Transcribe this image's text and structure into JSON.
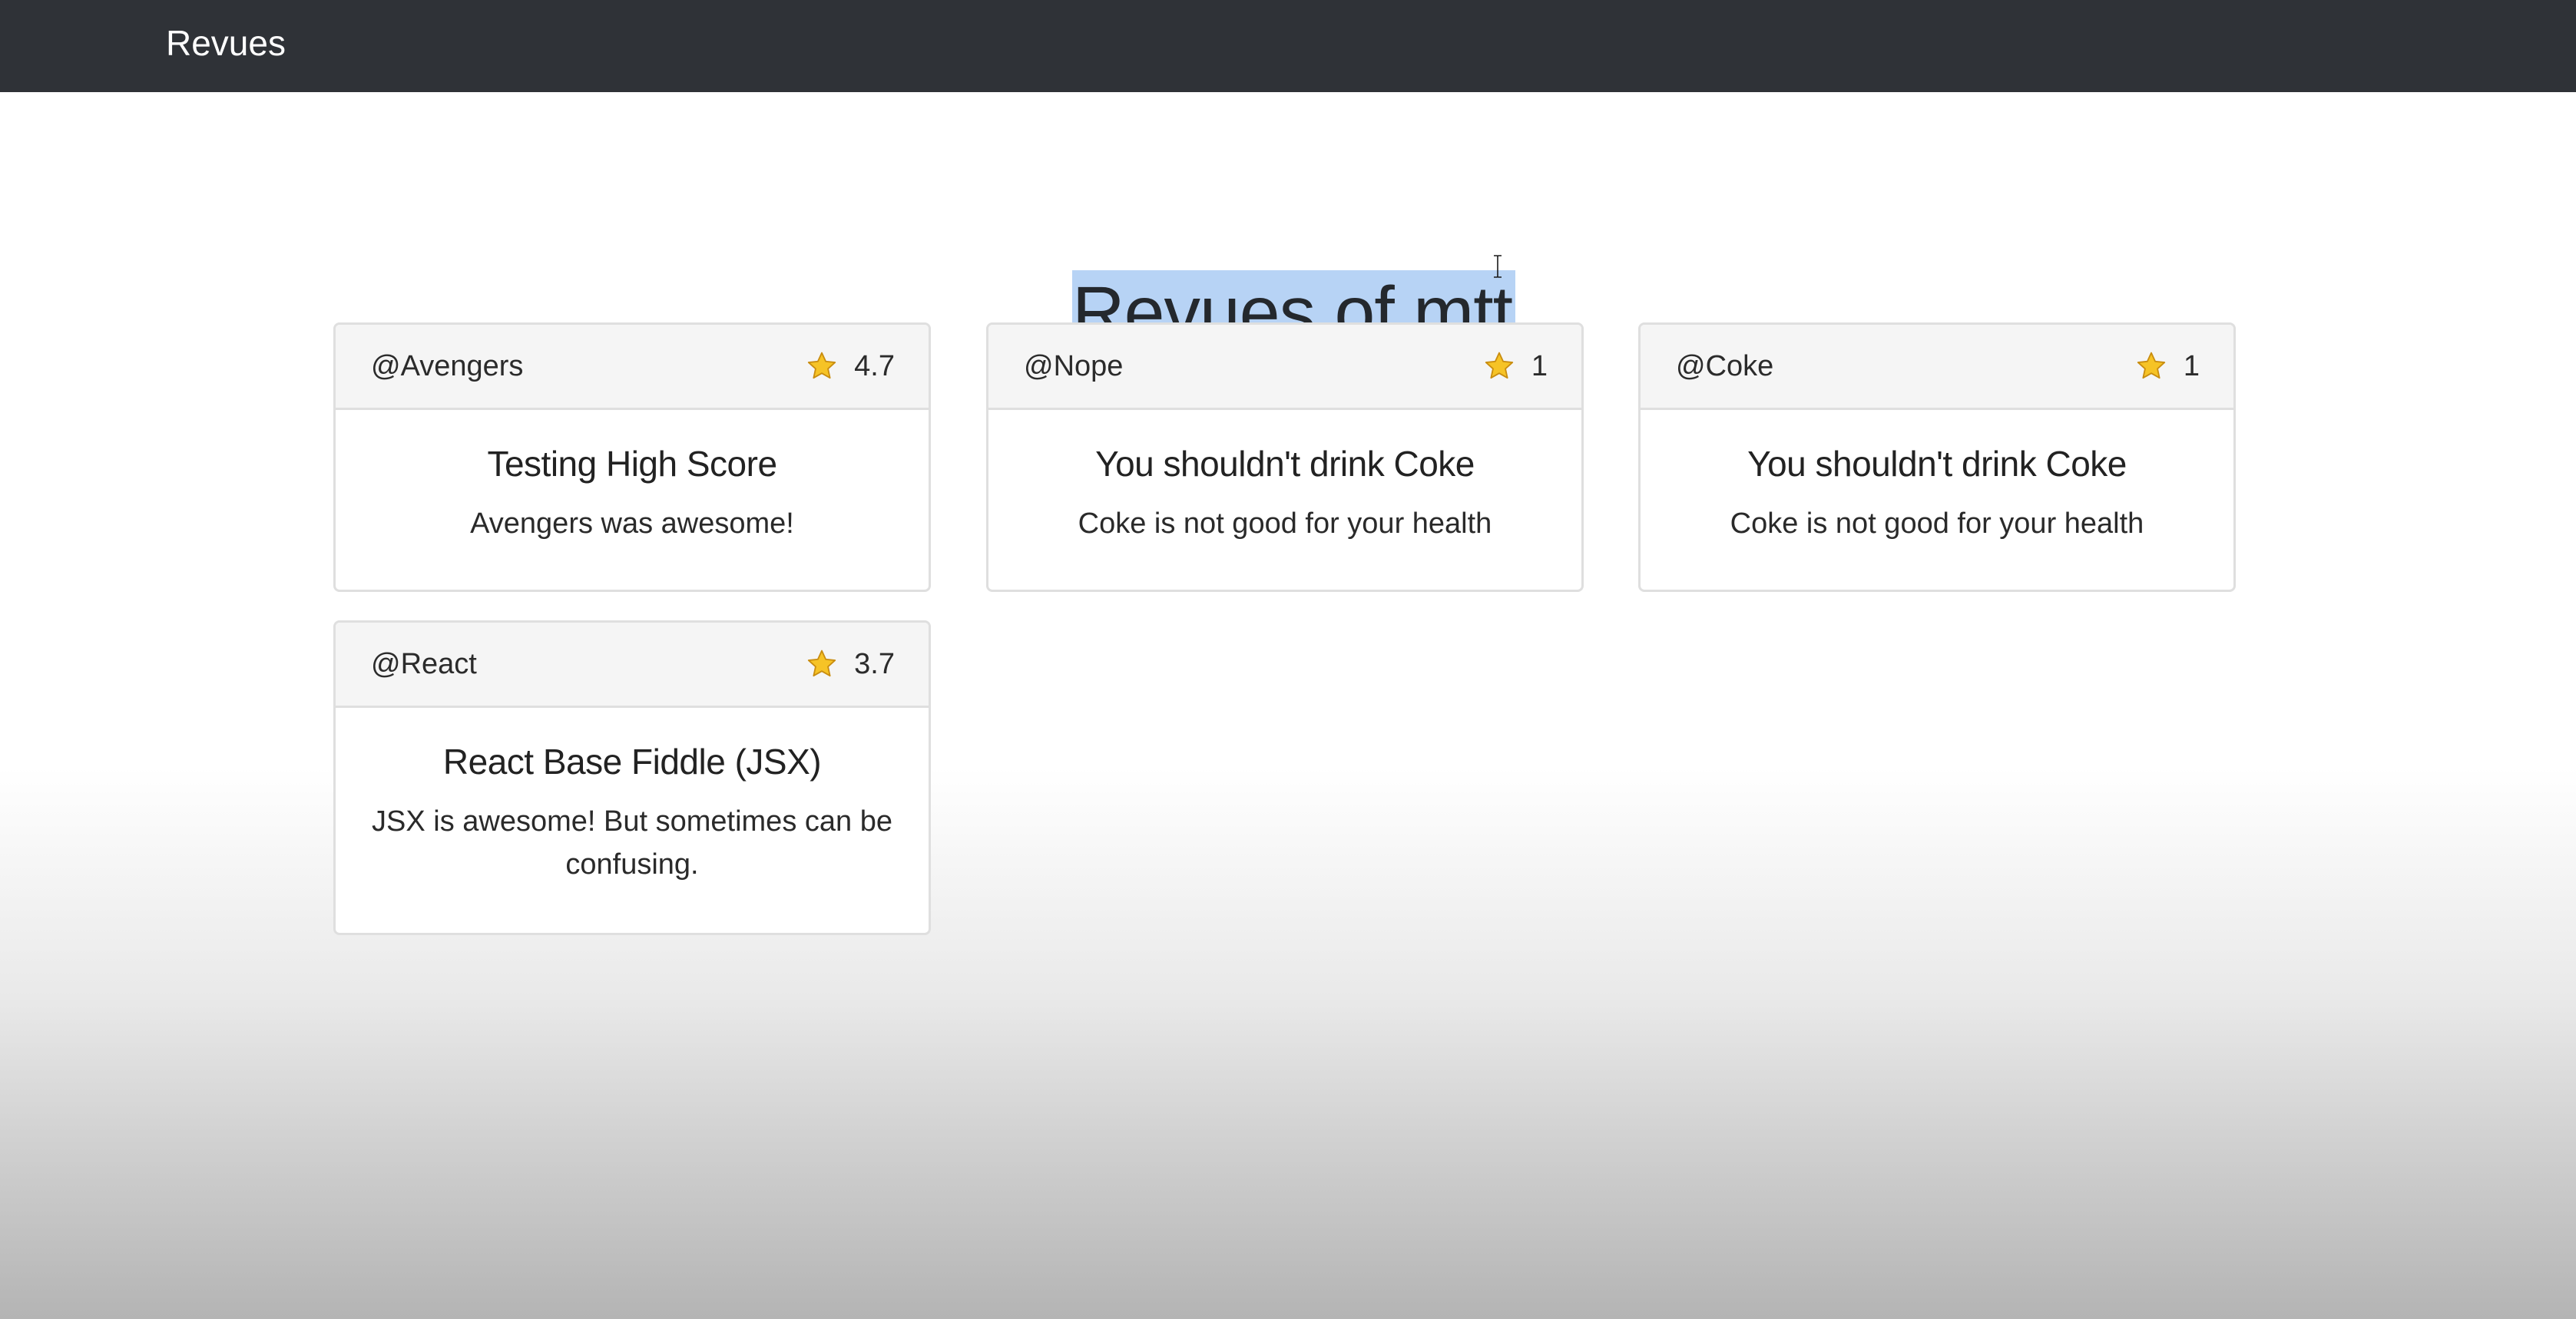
{
  "navbar": {
    "brand": "Revues"
  },
  "page": {
    "title": "Revues of mtt"
  },
  "reviews": [
    {
      "handle": "@Avengers",
      "rating": "4.7",
      "title": "Testing High Score",
      "text": "Avengers was awesome!"
    },
    {
      "handle": "@Nope",
      "rating": "1",
      "title": "You shouldn't drink Coke",
      "text": "Coke is not good for your health"
    },
    {
      "handle": "@Coke",
      "rating": "1",
      "title": "You shouldn't drink Coke",
      "text": "Coke is not good for your health"
    },
    {
      "handle": "@React",
      "rating": "3.7",
      "title": "React Base Fiddle (JSX)",
      "text": "JSX is awesome! But sometimes can be confusing."
    }
  ],
  "icons": {
    "rating": "star-icon",
    "pointer": "text-cursor-icon"
  },
  "colors": {
    "navbar": "#2f3237",
    "selection": "#b7d3f5",
    "star": "#f6c326"
  }
}
